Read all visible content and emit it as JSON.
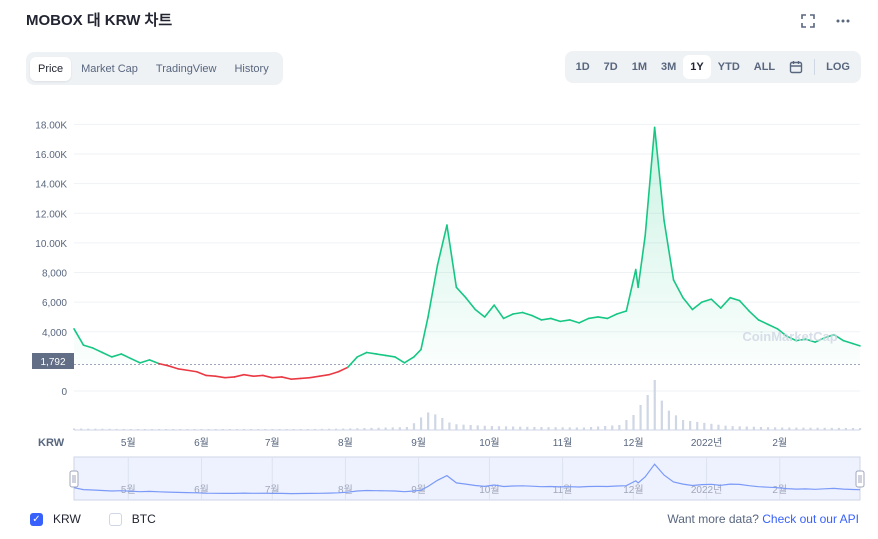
{
  "header": {
    "title": "MOBOX 대 KRW 차트",
    "fullscreen_icon": "fullscreen-icon",
    "more_icon": "more-icon"
  },
  "tabs": [
    {
      "label": "Price",
      "active": true
    },
    {
      "label": "Market Cap",
      "active": false
    },
    {
      "label": "TradingView",
      "active": false
    },
    {
      "label": "History",
      "active": false
    }
  ],
  "ranges": [
    {
      "label": "1D",
      "active": false
    },
    {
      "label": "7D",
      "active": false
    },
    {
      "label": "1M",
      "active": false
    },
    {
      "label": "3M",
      "active": false
    },
    {
      "label": "1Y",
      "active": true
    },
    {
      "label": "YTD",
      "active": false
    },
    {
      "label": "ALL",
      "active": false
    }
  ],
  "calendar_icon": "calendar-icon",
  "log_label": "LOG",
  "watermark": "CoinMarketCap",
  "chart_data": {
    "type": "line",
    "currency_label": "KRW",
    "y_ticks": [
      "18.00K",
      "16.00K",
      "14.00K",
      "12.00K",
      "10.00K",
      "8,000",
      "6,000",
      "4,000",
      "0"
    ],
    "ylim": [
      0,
      18500
    ],
    "baseline": {
      "value": 1792,
      "label": "1,792"
    },
    "x_ticks": [
      "5월",
      "6월",
      "7월",
      "8월",
      "9월",
      "10월",
      "11월",
      "12월",
      "2022년",
      "2월"
    ],
    "colors": {
      "up": "#16c784",
      "down": "#ea3943",
      "volume": "#cfd6e4",
      "navigator": "#7b9af8"
    },
    "series": [
      {
        "x": [
          "2021-04-08",
          "2021-04-12",
          "2021-04-16",
          "2021-04-20",
          "2021-04-24",
          "2021-04-28",
          "2021-05-02",
          "2021-05-06",
          "2021-05-10",
          "2021-05-14",
          "2021-05-18",
          "2021-05-22",
          "2021-05-26",
          "2021-05-30",
          "2021-06-03",
          "2021-06-07",
          "2021-06-11",
          "2021-06-15",
          "2021-06-19",
          "2021-06-23",
          "2021-06-27",
          "2021-07-01",
          "2021-07-05",
          "2021-07-09",
          "2021-07-13",
          "2021-07-17",
          "2021-07-21",
          "2021-07-25",
          "2021-07-29",
          "2021-08-02",
          "2021-08-06",
          "2021-08-10",
          "2021-08-14",
          "2021-08-18",
          "2021-08-22",
          "2021-08-26",
          "2021-08-30",
          "2021-09-02",
          "2021-09-05",
          "2021-09-09",
          "2021-09-13",
          "2021-09-17",
          "2021-09-21",
          "2021-09-25",
          "2021-09-29",
          "2021-10-03",
          "2021-10-07",
          "2021-10-11",
          "2021-10-15",
          "2021-10-19",
          "2021-10-23",
          "2021-10-27",
          "2021-10-31",
          "2021-11-04",
          "2021-11-08",
          "2021-11-12",
          "2021-11-16",
          "2021-11-20",
          "2021-11-24",
          "2021-11-28",
          "2021-12-01",
          "2021-12-02",
          "2021-12-03",
          "2021-12-06",
          "2021-12-10",
          "2021-12-14",
          "2021-12-18",
          "2021-12-22",
          "2021-12-26",
          "2021-12-30",
          "2022-01-03",
          "2022-01-07",
          "2022-01-11",
          "2022-01-15",
          "2022-01-19",
          "2022-01-23",
          "2022-01-27",
          "2022-01-31",
          "2022-02-04",
          "2022-02-08",
          "2022-02-12",
          "2022-02-16",
          "2022-02-20",
          "2022-02-24",
          "2022-02-28",
          "2022-03-04",
          "2022-03-07"
        ],
        "values": [
          4200,
          3100,
          2900,
          2600,
          2300,
          2500,
          2200,
          1900,
          2100,
          1850,
          1700,
          1500,
          1400,
          1300,
          1050,
          1000,
          900,
          950,
          1100,
          1000,
          1050,
          900,
          950,
          800,
          850,
          900,
          1000,
          1100,
          1300,
          1600,
          2300,
          2600,
          2500,
          2400,
          2300,
          1900,
          2300,
          2800,
          5000,
          8500,
          11200,
          7000,
          6300,
          5500,
          5000,
          5800,
          4900,
          5200,
          5300,
          5100,
          4800,
          4900,
          4700,
          4800,
          4600,
          4900,
          5000,
          4900,
          5200,
          5400,
          7500,
          8200,
          7000,
          10500,
          17800,
          11500,
          7500,
          6300,
          5500,
          6000,
          6200,
          5600,
          6300,
          6100,
          5400,
          4800,
          4500,
          4200,
          3700,
          3400,
          3500,
          3300,
          3600,
          3800,
          3400,
          3200,
          3050
        ]
      }
    ],
    "volume": {
      "x": [
        "2021-04-08",
        "2021-05-01",
        "2021-06-01",
        "2021-07-01",
        "2021-08-01",
        "2021-08-28",
        "2021-09-02",
        "2021-09-05",
        "2021-09-09",
        "2021-09-15",
        "2021-10-01",
        "2021-10-20",
        "2021-11-10",
        "2021-11-25",
        "2021-12-01",
        "2021-12-03",
        "2021-12-06",
        "2021-12-10",
        "2021-12-14",
        "2021-12-22",
        "2022-01-10",
        "2022-02-01",
        "2022-03-07"
      ],
      "values": [
        0.03,
        0.02,
        0.02,
        0.01,
        0.03,
        0.06,
        0.25,
        0.35,
        0.3,
        0.12,
        0.08,
        0.06,
        0.05,
        0.1,
        0.3,
        0.45,
        0.6,
        1.0,
        0.45,
        0.2,
        0.08,
        0.05,
        0.04
      ]
    }
  },
  "navigator": {
    "left_handle_icon": "drag-handle-icon",
    "right_handle_icon": "drag-handle-icon"
  },
  "legend": [
    {
      "label": "KRW",
      "checked": true
    },
    {
      "label": "BTC",
      "checked": false
    }
  ],
  "footer": {
    "prompt": "Want more data?",
    "link": "Check out our API"
  }
}
